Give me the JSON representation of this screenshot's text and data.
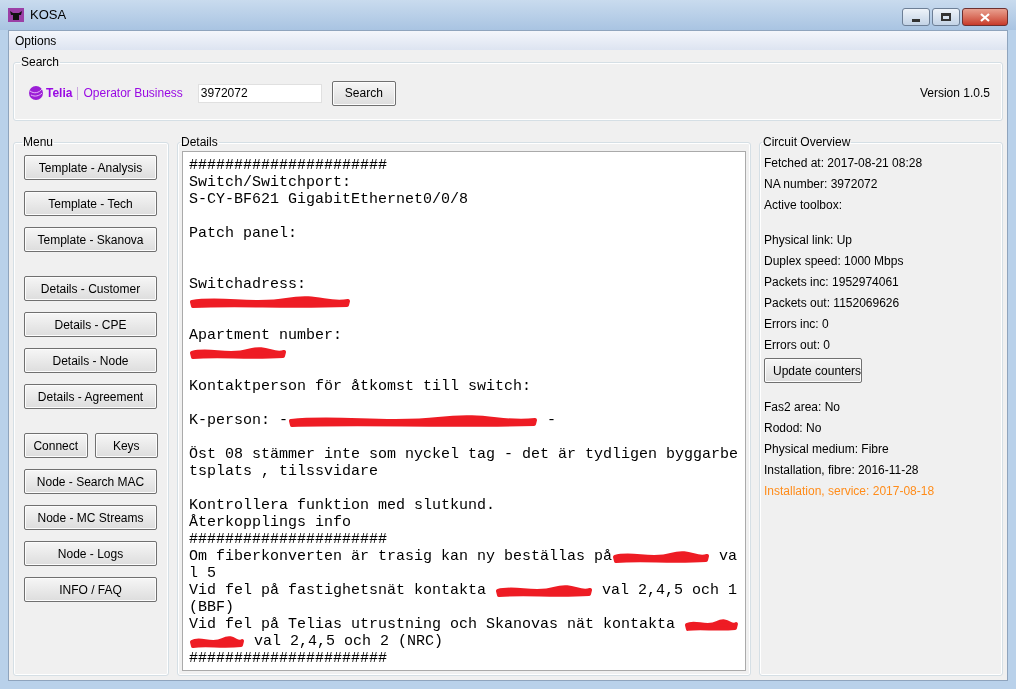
{
  "window": {
    "title": "KOSA"
  },
  "menu_bar": [
    "Options"
  ],
  "search": {
    "title": "Search",
    "logo_brand": "Telia",
    "logo_product": "Operator Business",
    "value": "3972072",
    "button": "Search",
    "version": "Version 1.0.5"
  },
  "menu": {
    "title": "Menu",
    "groups": [
      {
        "rows": [
          [
            "Template - Analysis"
          ],
          [
            "Template - Tech"
          ],
          [
            "Template - Skanova"
          ]
        ]
      },
      {
        "rows": [
          [
            "Details - Customer"
          ],
          [
            "Details - CPE"
          ],
          [
            "Details - Node"
          ],
          [
            "Details - Agreement"
          ]
        ]
      },
      {
        "rows": [
          [
            "Connect",
            "Keys"
          ],
          [
            "Node - Search MAC"
          ],
          [
            "Node - MC Streams"
          ],
          [
            "Node - Logs"
          ],
          [
            "INFO / FAQ"
          ]
        ]
      }
    ]
  },
  "details": {
    "title": "Details",
    "lines": [
      {
        "kind": "text",
        "segments": [
          {
            "kind": "text",
            "text": "######################"
          }
        ]
      },
      {
        "kind": "text",
        "segments": [
          {
            "kind": "text",
            "text": "Switch/Switchport:"
          }
        ]
      },
      {
        "kind": "text",
        "segments": [
          {
            "kind": "text",
            "text": "S-CY-BF621 GigabitEthernet0/0/8"
          }
        ]
      },
      {
        "kind": "blank"
      },
      {
        "kind": "text",
        "segments": [
          {
            "kind": "text",
            "text": "Patch panel:"
          }
        ]
      },
      {
        "kind": "blank"
      },
      {
        "kind": "blank"
      },
      {
        "kind": "text",
        "segments": [
          {
            "kind": "text",
            "text": "Switchadress:"
          }
        ]
      },
      {
        "kind": "text",
        "segments": [
          {
            "kind": "scribble-medium"
          }
        ]
      },
      {
        "kind": "blank"
      },
      {
        "kind": "text",
        "segments": [
          {
            "kind": "text",
            "text": "Apartment number:"
          }
        ]
      },
      {
        "kind": "text",
        "segments": [
          {
            "kind": "scribble-short"
          }
        ]
      },
      {
        "kind": "blank"
      },
      {
        "kind": "text",
        "segments": [
          {
            "kind": "text",
            "text": "Kontaktperson för åtkomst till switch:"
          }
        ]
      },
      {
        "kind": "blank"
      },
      {
        "kind": "text",
        "segments": [
          {
            "kind": "text",
            "text": "K-person: -"
          },
          {
            "kind": "scribble-long"
          },
          {
            "kind": "text",
            "text": " -"
          }
        ]
      },
      {
        "kind": "blank"
      },
      {
        "kind": "text",
        "segments": [
          {
            "kind": "text",
            "text": "Öst 08 stämmer inte som nyckel tag - det är tydligen byggarbe"
          }
        ]
      },
      {
        "kind": "text",
        "segments": [
          {
            "kind": "text",
            "text": "tsplats , tilssvidare"
          }
        ]
      },
      {
        "kind": "blank"
      },
      {
        "kind": "text",
        "segments": [
          {
            "kind": "text",
            "text": "Kontrollera funktion med slutkund."
          }
        ]
      },
      {
        "kind": "text",
        "segments": [
          {
            "kind": "text",
            "text": "Återkopplings info"
          }
        ]
      },
      {
        "kind": "text",
        "segments": [
          {
            "kind": "text",
            "text": "######################"
          }
        ]
      },
      {
        "kind": "text",
        "segments": [
          {
            "kind": "text",
            "text": "Om fiberkonverten är trasig kan ny beställas på"
          },
          {
            "kind": "scribble-short"
          },
          {
            "kind": "text",
            "text": " va"
          }
        ]
      },
      {
        "kind": "text",
        "segments": [
          {
            "kind": "text",
            "text": "l 5"
          }
        ]
      },
      {
        "kind": "text",
        "segments": [
          {
            "kind": "text",
            "text": "Vid fel på fastighetsnät kontakta "
          },
          {
            "kind": "scribble-short"
          },
          {
            "kind": "text",
            "text": " val 2,4,5 och 1"
          }
        ]
      },
      {
        "kind": "text",
        "segments": [
          {
            "kind": "text",
            "text": "(BBF)"
          }
        ]
      },
      {
        "kind": "text",
        "segments": [
          {
            "kind": "text",
            "text": "Vid fel på Telias utrustning och Skanovas nät kontakta "
          },
          {
            "kind": "scribble-tiny"
          }
        ]
      },
      {
        "kind": "text",
        "segments": [
          {
            "kind": "scribble-tiny"
          },
          {
            "kind": "text",
            "text": " val 2,4,5 och 2 (NRC)"
          }
        ]
      },
      {
        "kind": "text",
        "segments": [
          {
            "kind": "text",
            "text": "######################"
          }
        ]
      }
    ]
  },
  "circuit_overview": {
    "title": "Circuit Overview",
    "sections": [
      {
        "items": [
          {
            "text": "Fetched at: 2017-08-21 08:28",
            "highlighted": false
          },
          {
            "text": "NA number: 3972072",
            "highlighted": false
          },
          {
            "text": "Active toolbox:",
            "highlighted": false
          }
        ]
      },
      {
        "items": [
          {
            "text": "Physical link: Up",
            "highlighted": false
          },
          {
            "text": "Duplex speed: 1000 Mbps",
            "highlighted": false
          },
          {
            "text": "Packets inc: 1952974061",
            "highlighted": false
          },
          {
            "text": "Packets out: 1152069626",
            "highlighted": false
          },
          {
            "text": "Errors inc: 0",
            "highlighted": false
          },
          {
            "text": "Errors out: 0",
            "highlighted": false
          }
        ],
        "button": "Update counters"
      },
      {
        "items": [
          {
            "text": "Fas2 area: No",
            "highlighted": false
          },
          {
            "text": "Rodod: No",
            "highlighted": false
          },
          {
            "text": "Physical medium: Fibre",
            "highlighted": false
          },
          {
            "text": "Installation, fibre: 2016-11-28",
            "highlighted": false
          },
          {
            "text": "Installation, service: 2017-08-18",
            "highlighted": true
          }
        ]
      }
    ]
  }
}
